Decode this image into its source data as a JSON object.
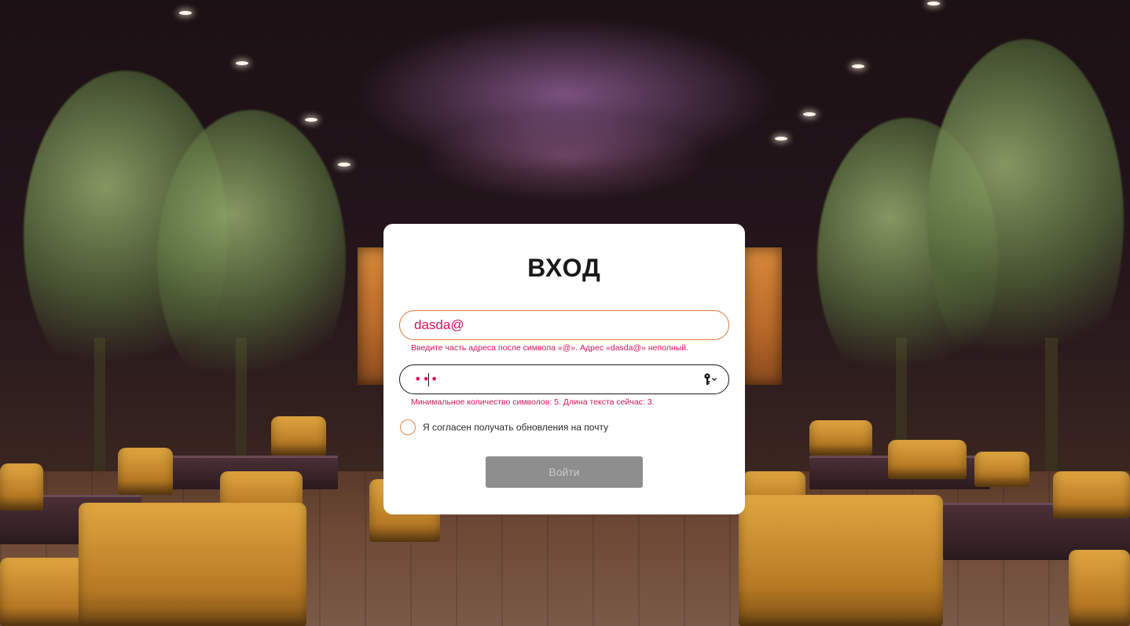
{
  "login": {
    "title": "ВХОД",
    "email": {
      "value": "dasda@",
      "error": "Введите часть адреса после символа «@». Адрес «dasda@» неполный."
    },
    "password": {
      "masked_value": "•••",
      "error": "Минимальное количество символов: 5. Длина текста сейчас: 3.",
      "icon": "key-icon"
    },
    "consent": {
      "label": "Я согласен получать обновления на почту",
      "checked": false
    },
    "submit": {
      "label": "Войти",
      "disabled": true
    }
  },
  "colors": {
    "error": "#d4145a",
    "email_border": "#e07a3a",
    "button_bg": "#8e8e8e",
    "button_text": "#c8c8c8",
    "card_bg": "#ffffff"
  },
  "background": {
    "icon": "restaurant-photo"
  }
}
